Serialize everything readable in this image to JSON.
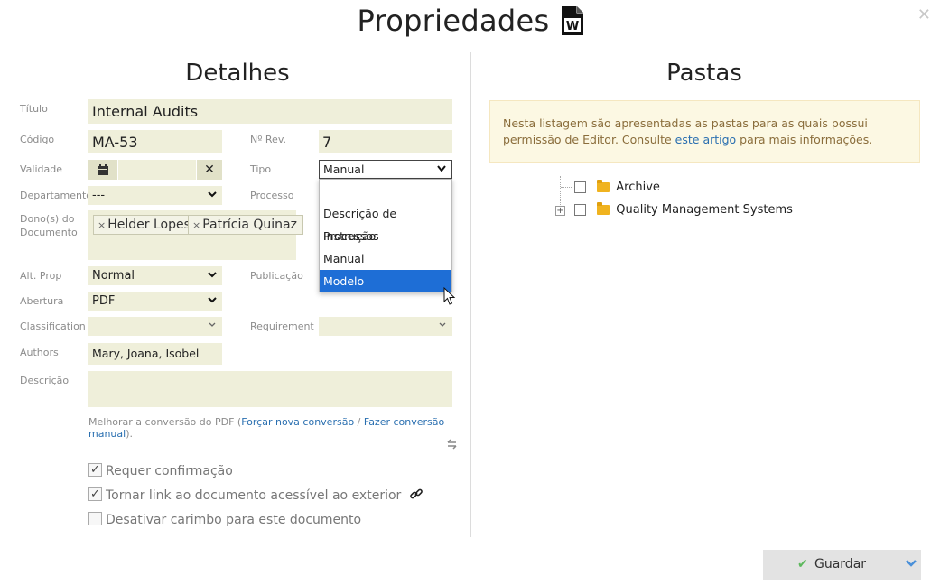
{
  "header": {
    "title": "Propriedades",
    "close_icon": "close-icon",
    "doc_icon_letter": "W"
  },
  "left": {
    "heading": "Detalhes",
    "labels": {
      "titulo": "Título",
      "codigo": "Código",
      "rev": "Nº Rev.",
      "validade": "Validade",
      "tipo": "Tipo",
      "departamento": "Departamento",
      "processo": "Processo",
      "donos": "Dono(s) do Documento",
      "alt_prop": "Alt. Prop",
      "publicacao": "Publicação",
      "abertura": "Abertura",
      "classification": "Classification",
      "requirement": "Requirement",
      "authors": "Authors",
      "descricao": "Descrição"
    },
    "values": {
      "titulo": "Internal Audits",
      "codigo": "MA-53",
      "rev": "7",
      "validade": "",
      "tipo": "Manual",
      "departamento": "---",
      "alt_prop": "Normal",
      "abertura": "PDF",
      "classification": "",
      "requirement": "",
      "authors": "Mary, Joana, Isobel",
      "descricao": ""
    },
    "owners": [
      "Helder Lopes",
      "Patrícia Quinaz"
    ],
    "tipo_options": [
      "",
      "Descrição de Processos",
      "Instrução",
      "Manual",
      "Modelo"
    ],
    "tipo_highlighted": "Modelo",
    "pdf_note": {
      "prefix": "Melhorar a conversão do PDF (",
      "link1": "Forçar nova conversão",
      "sep": " / ",
      "link2": "Fazer conversão manual",
      "suffix": ")."
    },
    "checkboxes": [
      {
        "label": "Requer confirmação",
        "checked": true
      },
      {
        "label": "Tornar link ao documento acessível ao exterior",
        "checked": true
      },
      {
        "label": "Desativar carimbo para este documento",
        "checked": false
      }
    ]
  },
  "right": {
    "heading": "Pastas",
    "notice": {
      "text1": "Nesta listagem são apresentadas as pastas para as quais possui permissão de Editor. Consulte ",
      "link": "este artigo",
      "text2": " para mais informações."
    },
    "folders": [
      {
        "name": "Archive",
        "expandable": false
      },
      {
        "name": "Quality Management Systems",
        "expandable": true
      }
    ]
  },
  "footer": {
    "save_label": "Guardar"
  },
  "colors": {
    "field_bg": "#efefda",
    "accent_blue": "#1e6ed6",
    "notice_bg": "#fcf8e3",
    "folder": "#f0b31f",
    "check_green": "#5cb85c"
  }
}
